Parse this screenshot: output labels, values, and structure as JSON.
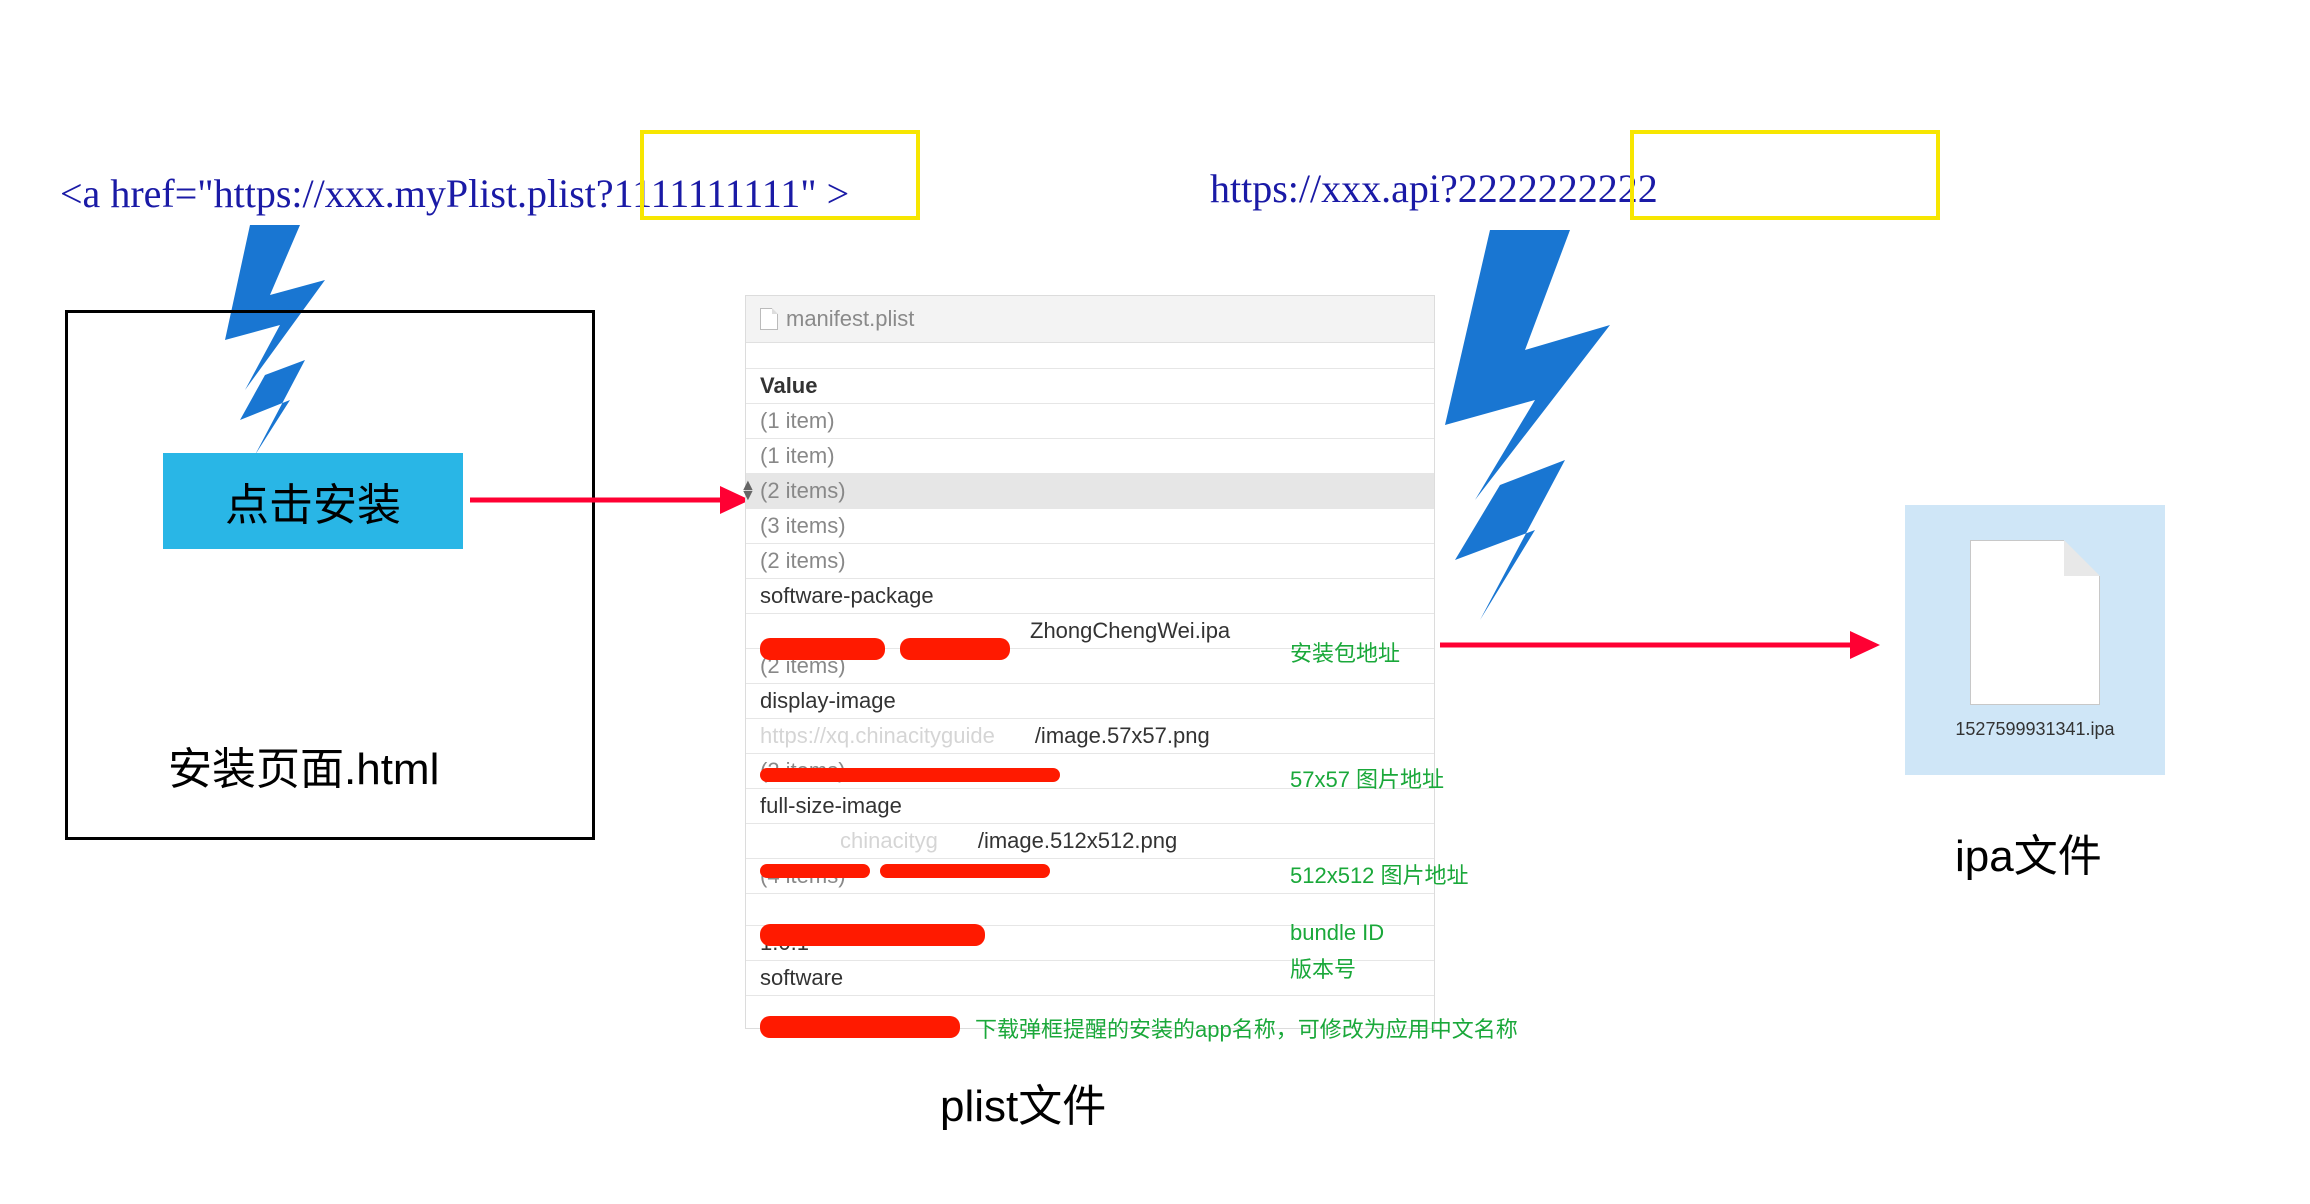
{
  "href1": "<a href=\"https://xxx.myPlist.plist?1111111111\" >",
  "href2": "https://xxx.api?2222222222",
  "installButton": "点击安装",
  "htmlCaption": "安装页面.html",
  "plistCaption": "plist文件",
  "ipaCaption": "ipa文件",
  "plist": {
    "filename": "manifest.plist",
    "valueHeader": "Value",
    "rows": [
      "(1 item)",
      "(1 item)",
      "(2 items)",
      "(3 items)",
      "(2 items)"
    ],
    "softwarePackage": {
      "key": "software-package",
      "file": "ZhongChengWei.ipa"
    },
    "twoItemsA": "(2 items)",
    "displayImage": {
      "key": "display-image",
      "file": "/image.57x57.png",
      "prefix": "https://xq.chinacityguide"
    },
    "twoItemsB": "(2 items)",
    "fullSizeImage": {
      "key": "full-size-image",
      "file": "/image.512x512.png",
      "prefix": "chinacityg"
    },
    "fourItems": "(4 items)",
    "version": "1.0.1",
    "software": "software"
  },
  "notes": {
    "pkg": "安装包地址",
    "img57": "57x57 图片地址",
    "img512": "512x512 图片地址",
    "bundle": "bundle ID",
    "version": "版本号",
    "appName": "下载弹框提醒的安装的app名称，可修改为应用中文名称"
  },
  "ipa": {
    "filename": "1527599931341.ipa"
  }
}
